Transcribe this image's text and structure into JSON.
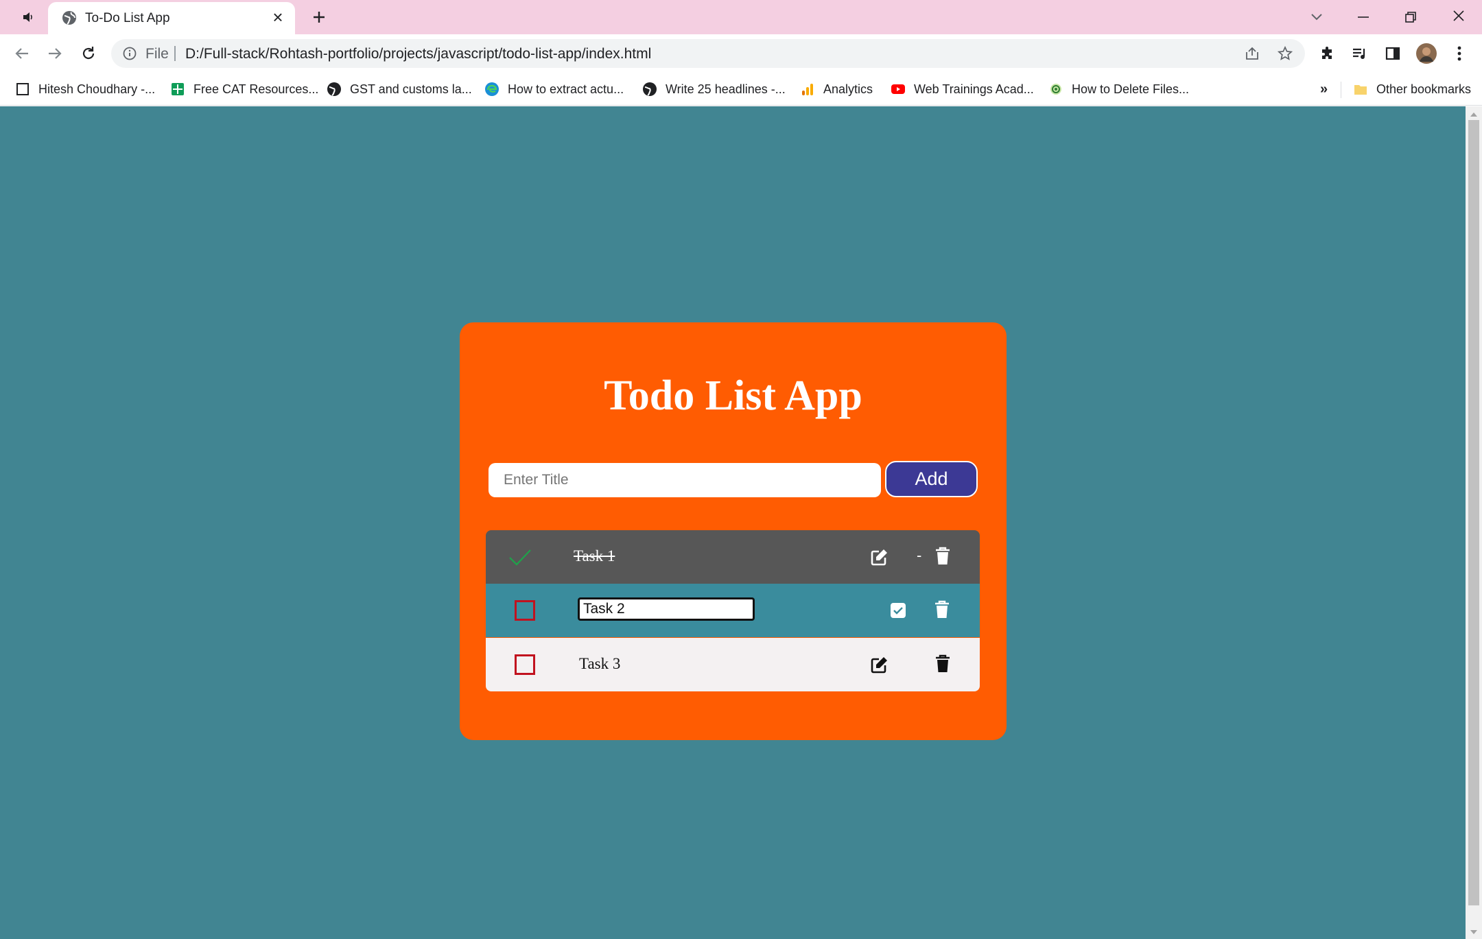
{
  "browser": {
    "tab": {
      "title": "To-Do List App"
    },
    "address": {
      "scheme_label": "File",
      "url": "D:/Full-stack/Rohtash-portfolio/projects/javascript/todo-list-app/index.html"
    },
    "bookmarks": [
      {
        "label": "Hitesh Choudhary -...",
        "icon": "page-icon"
      },
      {
        "label": "Free CAT Resources...",
        "icon": "sheets-icon"
      },
      {
        "label": "GST and customs la...",
        "icon": "globe-icon"
      },
      {
        "label": "How to extract actu...",
        "icon": "edge-icon"
      },
      {
        "label": "Write 25 headlines -...",
        "icon": "globe-icon"
      },
      {
        "label": "Analytics",
        "icon": "analytics-icon"
      },
      {
        "label": "Web Trainings Acad...",
        "icon": "youtube-icon"
      },
      {
        "label": "How to Delete Files...",
        "icon": "green-logo-icon"
      }
    ],
    "bookmarks_overflow": "»",
    "other_bookmarks": "Other bookmarks"
  },
  "app": {
    "title": "Todo List App",
    "input": {
      "placeholder": "Enter Title",
      "value": ""
    },
    "add_label": "Add",
    "tasks": [
      {
        "title": "Task 1",
        "completed": true,
        "editing": false
      },
      {
        "title": "Task 2",
        "completed": false,
        "editing": true
      },
      {
        "title": "Task 3",
        "completed": false,
        "editing": false
      }
    ],
    "task1_separator": "-"
  },
  "colors": {
    "page_bg": "#418592",
    "card_bg": "#ff5c02",
    "add_button": "#3c3995",
    "completed_row": "#575757",
    "editing_row": "#3a8c9d",
    "normal_row": "#f4f1f2",
    "checkbox_border": "#c1121f",
    "check_green": "#1ea34a"
  }
}
